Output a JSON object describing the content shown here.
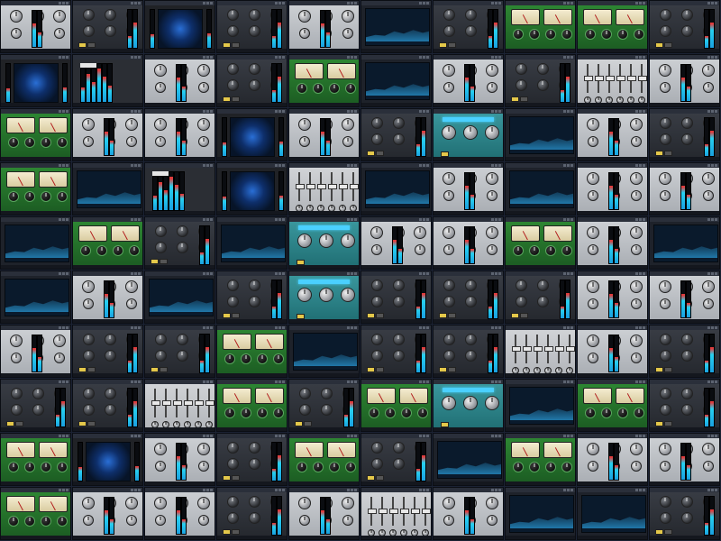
{
  "desktop": {
    "background_color": "#1b2233",
    "rows": 10,
    "columns": 10
  },
  "theme_colors": {
    "silver": "#bcc0c5",
    "dark": "#2f3238",
    "green": "#237a2b",
    "teal": "#2f8990",
    "eq": "#1e222a",
    "scope": "#202226",
    "fader": "#c4c6ca",
    "meter": "#2b2e34"
  },
  "plugin_grid": [
    [
      "silver",
      "dark",
      "scope",
      "dark",
      "silver",
      "eq",
      "dark",
      "green",
      "green",
      "dark"
    ],
    [
      "scope",
      "meter",
      "silver",
      "dark",
      "green",
      "eq",
      "silver",
      "dark",
      "fader",
      "silver"
    ],
    [
      "green",
      "silver",
      "silver",
      "scope",
      "silver",
      "dark",
      "teal",
      "eq",
      "silver",
      "dark"
    ],
    [
      "green",
      "eq",
      "meter",
      "scope",
      "fader",
      "eq",
      "silver",
      "eq",
      "silver",
      "silver"
    ],
    [
      "eq",
      "green",
      "dark",
      "eq",
      "teal",
      "silver",
      "silver",
      "green",
      "silver",
      "eq"
    ],
    [
      "eq",
      "silver",
      "eq",
      "dark",
      "teal",
      "dark",
      "dark",
      "dark",
      "silver",
      "silver"
    ],
    [
      "silver",
      "dark",
      "dark",
      "green",
      "eq",
      "dark",
      "dark",
      "fader",
      "silver",
      "dark"
    ],
    [
      "dark",
      "dark",
      "fader",
      "green",
      "dark",
      "green",
      "teal",
      "eq",
      "green",
      "dark"
    ],
    [
      "green",
      "scope",
      "silver",
      "dark",
      "green",
      "dark",
      "eq",
      "green",
      "silver",
      "silver"
    ],
    [
      "green",
      "silver",
      "silver",
      "dark",
      "silver",
      "fader",
      "silver",
      "eq",
      "eq",
      "dark"
    ]
  ]
}
